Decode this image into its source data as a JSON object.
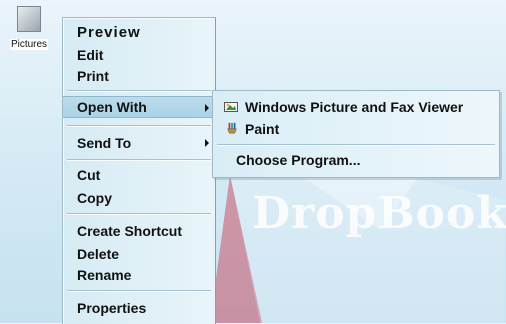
{
  "desktop": {
    "icon_label": "Pictures",
    "watermark": "DropBook"
  },
  "context_menu": {
    "items": [
      {
        "label": "Preview"
      },
      {
        "label": "Edit"
      },
      {
        "label": "Print"
      },
      {
        "label": "Open With",
        "has_submenu": true,
        "highlighted": true
      },
      {
        "label": "Send To",
        "has_submenu": true
      },
      {
        "label": "Cut"
      },
      {
        "label": "Copy"
      },
      {
        "label": "Create Shortcut"
      },
      {
        "label": "Delete"
      },
      {
        "label": "Rename"
      },
      {
        "label": "Properties"
      }
    ]
  },
  "open_with_submenu": {
    "items": [
      {
        "label": "Windows Picture and Fax Viewer",
        "icon": "picture-viewer-icon"
      },
      {
        "label": "Paint",
        "icon": "paint-icon"
      },
      {
        "label": "Choose Program..."
      }
    ]
  },
  "colors": {
    "menu_bg": "#e1f1f8",
    "highlight": "#afd4e8",
    "desktop_bg": "#d9ecf6",
    "accent_red": "#c8324a"
  }
}
